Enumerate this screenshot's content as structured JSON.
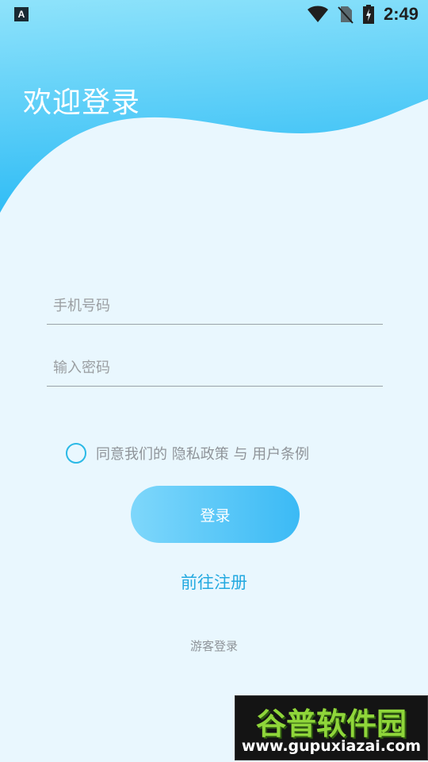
{
  "status_bar": {
    "time": "2:49",
    "left_icon": "a-badge-icon",
    "icons": [
      "wifi-icon",
      "no-sim-icon",
      "battery-charging-icon"
    ]
  },
  "header": {
    "title": "欢迎登录"
  },
  "form": {
    "phone_placeholder": "手机号码",
    "password_placeholder": "输入密码",
    "agree_text": "同意我们的 隐私政策 与 用户条例",
    "login_label": "登录",
    "register_label": "前往注册",
    "guest_label": "游客登录"
  },
  "watermark": {
    "title": "谷普软件园",
    "url": "www.gupuxiazai.com"
  },
  "colors": {
    "accent": "#23a9e0",
    "background": "#e9f7fe",
    "wave_top": "#8fe3fb",
    "wave_bottom": "#3ec3f7"
  }
}
